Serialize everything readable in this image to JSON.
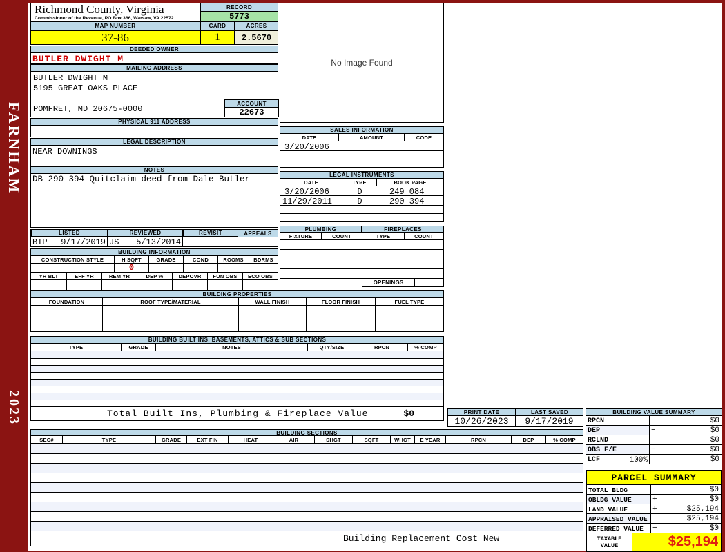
{
  "banner": {
    "region": "FARNHAM",
    "year": "2023"
  },
  "header": {
    "county_title": "Richmond County, Virginia",
    "county_subtitle": "Commissioner of the Revenue, PO Box 366, Warsaw, VA 22572",
    "record_label": "RECORD",
    "record_value": "5773",
    "map_number_label": "MAP NUMBER",
    "map_number_value": "37-86",
    "card_label": "CARD",
    "card_value": "1",
    "acres_label": "ACRES",
    "acres_value": "2.5670"
  },
  "owner": {
    "deeded_owner_label": "DEEDED OWNER",
    "deeded_owner": "BUTLER DWIGHT M",
    "mailing_address_label": "MAILING ADDRESS",
    "mailing_lines": [
      "BUTLER DWIGHT M",
      "5195 GREAT OAKS PLACE",
      "POMFRET, MD 20675-0000"
    ],
    "account_label": "ACCOUNT",
    "account_value": "22673",
    "physical_address_label": "PHYSICAL 911 ADDRESS",
    "legal_description_label": "LEGAL DESCRIPTION",
    "legal_description": "NEAR DOWNINGS",
    "notes_label": "NOTES",
    "notes": "DB 290-394 Quitclaim deed from Dale Butler"
  },
  "review": {
    "headers": [
      "LISTED",
      "REVIEWED",
      "REVISIT",
      "APPEALS"
    ],
    "listed_by": "BTP",
    "listed_date": "9/17/2019",
    "reviewed_by": "JS",
    "reviewed_date": "5/13/2014"
  },
  "image_panel": {
    "no_image_text": "No Image Found"
  },
  "sales": {
    "title": "SALES INFORMATION",
    "headers": [
      "DATE",
      "AMOUNT",
      "CODE"
    ],
    "rows": [
      {
        "date": "3/20/2006",
        "amount": "",
        "code": ""
      }
    ]
  },
  "legal_instruments": {
    "title": "LEGAL INSTRUMENTS",
    "headers": [
      "DATE",
      "TYPE",
      "BOOK PAGE"
    ],
    "rows": [
      {
        "date": "3/20/2006",
        "type": "D",
        "book_page": "249 084"
      },
      {
        "date": "11/29/2011",
        "type": "D",
        "book_page": "290 394"
      }
    ]
  },
  "plumbing": {
    "title": "PLUMBING",
    "headers": [
      "FIXTURE",
      "COUNT"
    ]
  },
  "fireplaces": {
    "title": "FIREPLACES",
    "headers": [
      "TYPE",
      "COUNT"
    ],
    "openings_label": "OPENINGS"
  },
  "building_information": {
    "title": "BUILDING INFORMATION",
    "row1_headers": [
      "CONSTRUCTION STYLE",
      "H SQFT",
      "GRADE",
      "COND",
      "ROOMS",
      "BDRMS"
    ],
    "h_sqft_value": "0",
    "row2_headers": [
      "YR BLT",
      "EFF YR",
      "REM YR",
      "DEP %",
      "DEPOVR",
      "FUN OBS",
      "ECO OBS"
    ]
  },
  "building_properties": {
    "title": "BUILDING PROPERTIES",
    "headers": [
      "FOUNDATION",
      "ROOF TYPE/MATERIAL",
      "WALL FINISH",
      "FLOOR FINISH",
      "FUEL TYPE"
    ]
  },
  "built_ins": {
    "title": "BUILDING BUILT INS, BASEMENTS, ATTICS & SUB SECTIONS",
    "headers": [
      "TYPE",
      "GRADE",
      "NOTES",
      "QTY/SIZE",
      "RPCN",
      "% COMP"
    ],
    "total_label": "Total Built Ins, Plumbing & Fireplace Value",
    "total_value": "$0"
  },
  "print_info": {
    "print_date_label": "PRINT DATE",
    "print_date": "10/26/2023",
    "last_saved_label": "LAST SAVED",
    "last_saved": "9/17/2019"
  },
  "building_value_summary": {
    "title": "BUILDING VALUE SUMMARY",
    "rows": [
      {
        "label": "RPCN",
        "op": "",
        "value": "$0"
      },
      {
        "label": "DEP",
        "op": "−",
        "value": "$0"
      },
      {
        "label": "RCLND",
        "op": "",
        "value": "$0"
      },
      {
        "label": "OBS F/E",
        "op": "−",
        "value": "$0"
      },
      {
        "label": "LCF",
        "extra": "100%",
        "op": "",
        "value": "$0"
      }
    ]
  },
  "building_sections": {
    "title": "BUILDING SECTIONS",
    "headers": [
      "SEC#",
      "TYPE",
      "GRADE",
      "EXT FIN",
      "HEAT",
      "AIR",
      "SHGT",
      "SQFT",
      "WHGT",
      "E YEAR",
      "RPCN",
      "DEP",
      "% COMP"
    ]
  },
  "parcel_summary": {
    "title": "PARCEL SUMMARY",
    "rows": [
      {
        "label": "TOTAL BLDG VALUE",
        "op": "",
        "value": "$0"
      },
      {
        "label": "OBLDG VALUE",
        "op": "+",
        "value": "$0"
      },
      {
        "label": "LAND VALUE",
        "op": "+",
        "value": "$25,194"
      },
      {
        "label": "APPRAISED VALUE",
        "op": "",
        "value": "$25,194"
      },
      {
        "label": "DEFERRED VALUE",
        "op": "−",
        "value": "$0"
      }
    ],
    "taxable_label": "TAXABLE VALUE",
    "taxable_value": "$25,194"
  },
  "footer": {
    "note": "Building Replacement Cost New"
  },
  "colors": {
    "frame": "#8B1412",
    "section_header": "#BDD9E8",
    "record_green": "#A6E3A6",
    "highlight_yellow": "#FFFF00",
    "acres_cream": "#F0EFDB",
    "owner_red": "#CC0000",
    "taxable_red": "#E02010"
  }
}
